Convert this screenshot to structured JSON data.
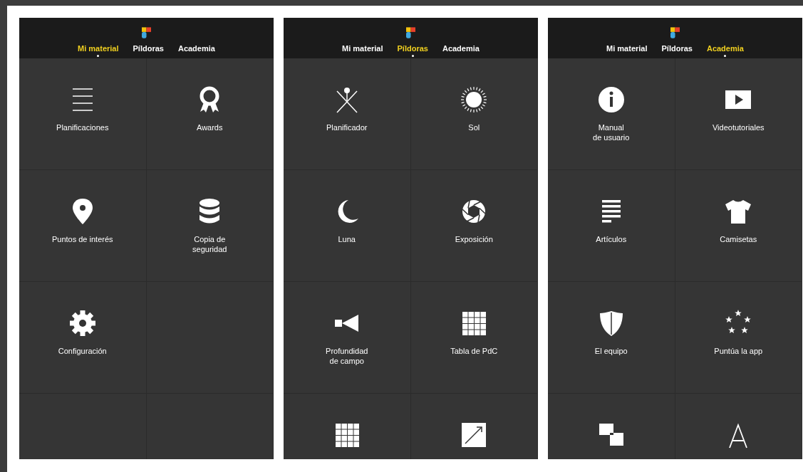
{
  "screens": [
    {
      "tabs": [
        {
          "label": "Mi material",
          "selected": true
        },
        {
          "label": "Píldoras",
          "selected": false
        },
        {
          "label": "Academia",
          "selected": false
        }
      ],
      "tiles": [
        {
          "kind": "lines",
          "label": "Planificaciones"
        },
        {
          "kind": "award",
          "label": "Awards"
        },
        {
          "kind": "pin",
          "label": "Puntos de interés"
        },
        {
          "kind": "database",
          "label": "Copia de\nseguridad"
        },
        {
          "kind": "gear",
          "label": "Configuración"
        },
        {
          "kind": "blank"
        },
        {
          "kind": "blank"
        },
        {
          "kind": "blank"
        }
      ]
    },
    {
      "tabs": [
        {
          "label": "Mi material",
          "selected": false
        },
        {
          "label": "Píldoras",
          "selected": true
        },
        {
          "label": "Academia",
          "selected": false
        }
      ],
      "tiles": [
        {
          "kind": "planner",
          "label": "Planificador"
        },
        {
          "kind": "sun",
          "label": "Sol"
        },
        {
          "kind": "moon",
          "label": "Luna"
        },
        {
          "kind": "aperture",
          "label": "Exposición"
        },
        {
          "kind": "cone",
          "label": "Profundidad\nde campo"
        },
        {
          "kind": "grid",
          "label": "Tabla de PdC"
        },
        {
          "kind": "grid"
        },
        {
          "kind": "diagonal"
        }
      ]
    },
    {
      "tabs": [
        {
          "label": "Mi material",
          "selected": false
        },
        {
          "label": "Píldoras",
          "selected": false
        },
        {
          "label": "Academia",
          "selected": true
        }
      ],
      "tiles": [
        {
          "kind": "info",
          "label": "Manual\nde usuario"
        },
        {
          "kind": "play",
          "label": "Videotutoriales"
        },
        {
          "kind": "article",
          "label": "Artículos"
        },
        {
          "kind": "shirt",
          "label": "Camisetas"
        },
        {
          "kind": "shield",
          "label": "El equipo"
        },
        {
          "kind": "stars",
          "label": "Puntúa la app"
        },
        {
          "kind": "squares"
        },
        {
          "kind": "letter"
        }
      ]
    }
  ]
}
